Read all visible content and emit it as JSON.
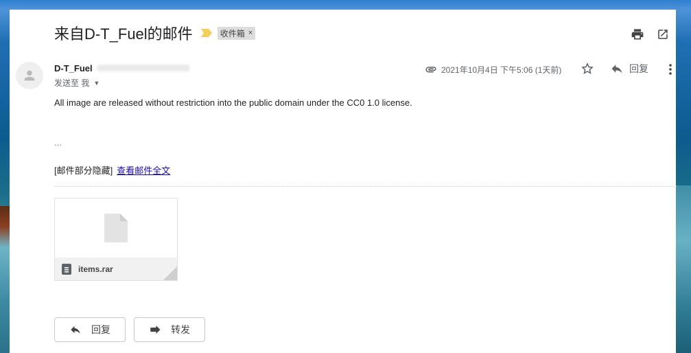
{
  "email": {
    "subject": "来自D-T_Fuel的邮件",
    "label": "收件箱",
    "label_close": "×",
    "sender_name": "D-T_Fuel",
    "sent_to": "发送至 我",
    "date": "2021年10月4日 下午5:06 (1天前)",
    "reply_label": "回复",
    "body_text": "All image are released without restriction into the public domain under the CC0 1.0 license.",
    "ellipsis": "...",
    "hidden_notice": "[邮件部分隐藏]",
    "view_full": "查看邮件全文"
  },
  "attachment": {
    "filename": "items.rar"
  },
  "actions": {
    "reply": "回复",
    "forward": "转发"
  },
  "icons": {
    "importance": "importance-marker-icon",
    "print": "print-icon",
    "open_new_window": "open-in-new-icon",
    "avatar": "person-icon",
    "attachment": "paperclip-icon",
    "star": "star-icon",
    "reply": "reply-icon",
    "more": "more-vert-icon",
    "file": "file-icon",
    "forward": "forward-icon"
  },
  "colors": {
    "link": "#1a0dab",
    "importance": "#f4cf5a",
    "label_bg": "#dddddd"
  }
}
